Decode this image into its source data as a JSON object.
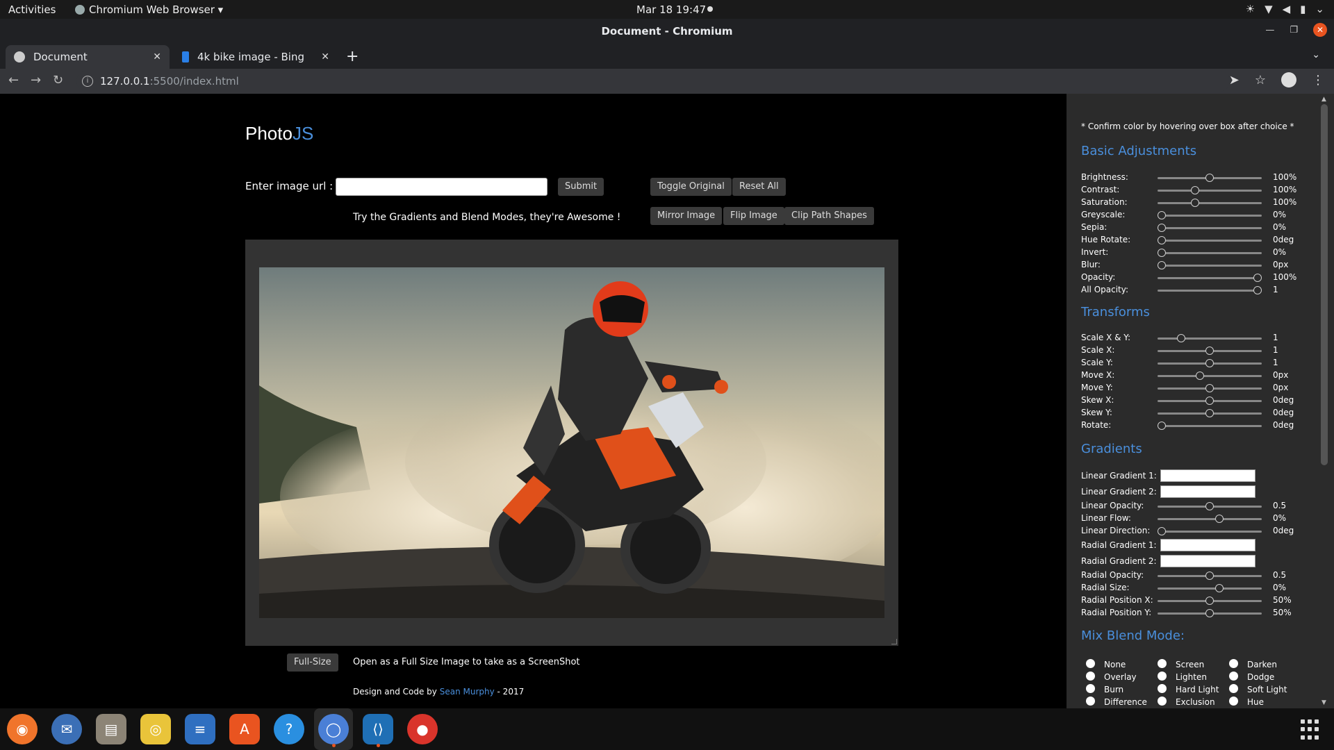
{
  "topbar": {
    "activities": "Activities",
    "app_name": "Chromium Web Browser ▾",
    "clock": "Mar 18  19:47"
  },
  "browser": {
    "window_title": "Document - Chromium",
    "tabs": [
      {
        "label": "Document",
        "active": true
      },
      {
        "label": "4k bike image - Bing",
        "active": false
      }
    ],
    "url_host": "127.0.0.1",
    "url_path": ":5500/index.html"
  },
  "page": {
    "logo_photo": "Photo",
    "logo_js": "JS",
    "url_label": "Enter image url :",
    "url_input_value": "",
    "buttons": {
      "submit": "Submit",
      "toggle_original": "Toggle Original",
      "reset_all": "Reset All",
      "mirror_image": "Mirror Image",
      "flip_image": "Flip Image",
      "clip_path_shapes": "Clip Path Shapes",
      "full_size": "Full-Size"
    },
    "tip": "Try the Gradients and Blend Modes, they're Awesome !",
    "fullsize_note": "Open as a Full Size Image to take as a ScreenShot",
    "credit_prefix": "Design and Code by ",
    "credit_author": "Sean Murphy",
    "credit_suffix": " - 2017"
  },
  "sidebar": {
    "confirm_note": "* Confirm color by hovering over box after choice *",
    "basic_title": "Basic Adjustments",
    "basic": [
      {
        "label": "Brightness:",
        "value": "100%",
        "level": 0.5
      },
      {
        "label": "Contrast:",
        "value": "100%",
        "level": 0.35
      },
      {
        "label": "Saturation:",
        "value": "100%",
        "level": 0.35
      },
      {
        "label": "Greyscale:",
        "value": "0%",
        "level": 0
      },
      {
        "label": "Sepia:",
        "value": "0%",
        "level": 0
      },
      {
        "label": "Hue Rotate:",
        "value": "0deg",
        "level": 0
      },
      {
        "label": "Invert:",
        "value": "0%",
        "level": 0
      },
      {
        "label": "Blur:",
        "value": "0px",
        "level": 0
      },
      {
        "label": "Opacity:",
        "value": "100%",
        "level": 1
      },
      {
        "label": "All Opacity:",
        "value": "1",
        "level": 1
      }
    ],
    "transforms_title": "Transforms",
    "transforms": [
      {
        "label": "Scale X & Y:",
        "value": "1",
        "level": 0.2
      },
      {
        "label": "Scale X:",
        "value": "1",
        "level": 0.5
      },
      {
        "label": "Scale Y:",
        "value": "1",
        "level": 0.5
      },
      {
        "label": "Move X:",
        "value": "0px",
        "level": 0.4
      },
      {
        "label": "Move Y:",
        "value": "0px",
        "level": 0.5
      },
      {
        "label": "Skew X:",
        "value": "0deg",
        "level": 0.5
      },
      {
        "label": "Skew Y:",
        "value": "0deg",
        "level": 0.5
      },
      {
        "label": "Rotate:",
        "value": "0deg",
        "level": 0
      }
    ],
    "gradients_title": "Gradients",
    "gradients": [
      {
        "label": "Linear Gradient 1:",
        "kind": "color"
      },
      {
        "label": "Linear Gradient 2:",
        "kind": "color"
      },
      {
        "label": "Linear Opacity:",
        "value": "0.5",
        "level": 0.5,
        "kind": "slider"
      },
      {
        "label": "Linear Flow:",
        "value": "0%",
        "level": 0.6,
        "kind": "slider"
      },
      {
        "label": "Linear Direction:",
        "value": "0deg",
        "level": 0,
        "kind": "slider"
      },
      {
        "label": "Radial Gradient 1:",
        "kind": "color"
      },
      {
        "label": "Radial Gradient 2:",
        "kind": "color"
      },
      {
        "label": "Radial Opacity:",
        "value": "0.5",
        "level": 0.5,
        "kind": "slider"
      },
      {
        "label": "Radial Size:",
        "value": "0%",
        "level": 0.6,
        "kind": "slider"
      },
      {
        "label": "Radial Position X:",
        "value": "50%",
        "level": 0.5,
        "kind": "slider"
      },
      {
        "label": "Radial Position Y:",
        "value": "50%",
        "level": 0.5,
        "kind": "slider"
      }
    ],
    "blend_title": "Mix Blend Mode:",
    "blend_modes": [
      [
        "None",
        "Screen",
        "Darken"
      ],
      [
        "Overlay",
        "Lighten",
        "Dodge"
      ],
      [
        "Burn",
        "Hard Light",
        "Soft Light"
      ],
      [
        "Difference",
        "Exclusion",
        "Hue"
      ]
    ]
  },
  "colors": {
    "accent": "#4a8fdc",
    "sidebar_bg": "#2b2b2b",
    "frame_bg": "#333333"
  },
  "dock": {
    "apps": [
      "firefox-icon",
      "thunderbird-icon",
      "files-icon",
      "rhythmbox-icon",
      "writer-icon",
      "software-icon",
      "help-icon",
      "chromium-icon",
      "vscode-icon",
      "chrome-icon"
    ]
  }
}
